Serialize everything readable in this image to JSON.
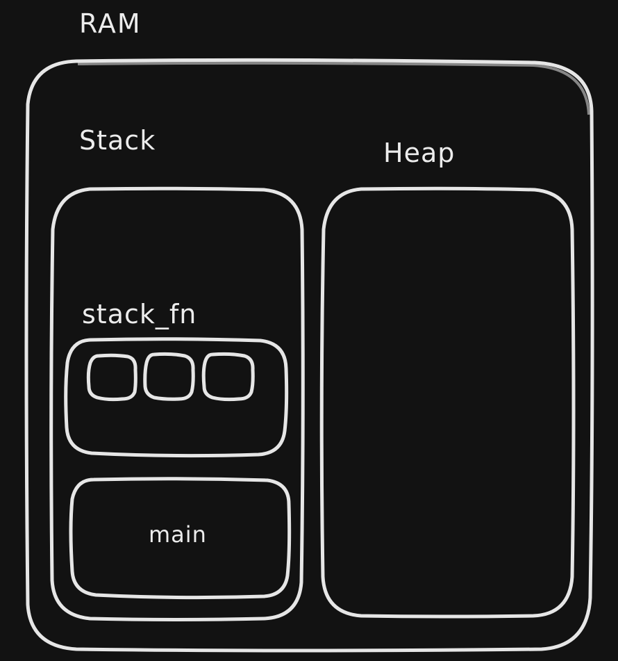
{
  "diagram": {
    "ram_label": "RAM",
    "stack_label": "Stack",
    "heap_label": "Heap",
    "stack_frames": [
      {
        "label": "stack_fn",
        "slots": 3
      },
      {
        "label": "main"
      }
    ],
    "colors": {
      "background": "#121212",
      "stroke": "#e6e6e6",
      "text": "#ececec"
    }
  }
}
